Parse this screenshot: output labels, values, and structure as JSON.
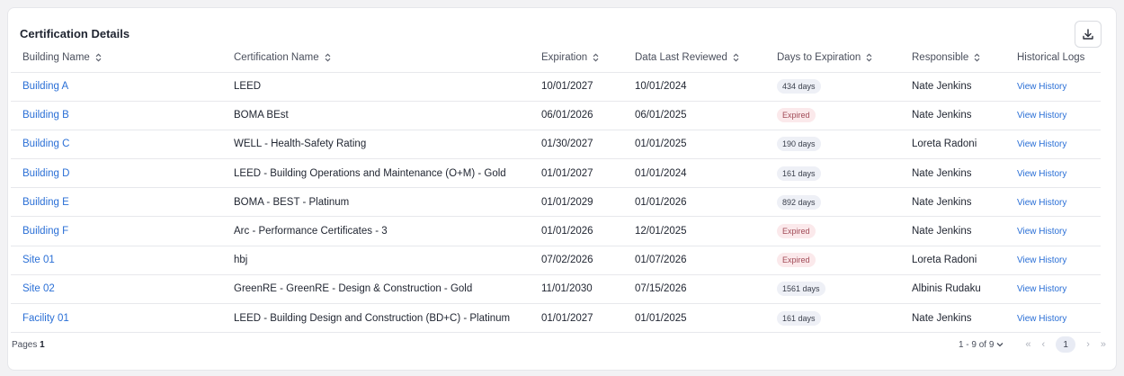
{
  "header": {
    "title": "Certification Details",
    "download_icon": "download-icon"
  },
  "columns": [
    "Building Name",
    "Certification Name",
    "Expiration",
    "Data Last Reviewed",
    "Days to Expiration",
    "Responsible",
    "Historical Logs"
  ],
  "rows": [
    {
      "building": "Building A",
      "certification": "LEED",
      "expiration": "10/01/2027",
      "reviewed": "10/01/2024",
      "days": "434 days",
      "status": "days",
      "responsible": "Nate Jenkins",
      "history": "View History"
    },
    {
      "building": "Building B",
      "certification": "BOMA BEst",
      "expiration": "06/01/2026",
      "reviewed": "06/01/2025",
      "days": "Expired",
      "status": "expired",
      "responsible": "Nate Jenkins",
      "history": "View History"
    },
    {
      "building": "Building C",
      "certification": "WELL - Health-Safety Rating",
      "expiration": "01/30/2027",
      "reviewed": "01/01/2025",
      "days": "190 days",
      "status": "days",
      "responsible": "Loreta Radoni",
      "history": "View History"
    },
    {
      "building": "Building D",
      "certification": "LEED - Building Operations and Maintenance (O+M) - Gold",
      "expiration": "01/01/2027",
      "reviewed": "01/01/2024",
      "days": "161 days",
      "status": "days",
      "responsible": "Nate Jenkins",
      "history": "View History"
    },
    {
      "building": "Building E",
      "certification": "BOMA - BEST - Platinum",
      "expiration": "01/01/2029",
      "reviewed": "01/01/2026",
      "days": "892 days",
      "status": "days",
      "responsible": "Nate Jenkins",
      "history": "View History"
    },
    {
      "building": "Building F",
      "certification": "Arc - Performance Certificates - 3",
      "expiration": "01/01/2026",
      "reviewed": "12/01/2025",
      "days": "Expired",
      "status": "expired",
      "responsible": "Nate Jenkins",
      "history": "View History"
    },
    {
      "building": "Site 01",
      "certification": "hbj",
      "expiration": "07/02/2026",
      "reviewed": "01/07/2026",
      "days": "Expired",
      "status": "expired",
      "responsible": "Loreta Radoni",
      "history": "View History"
    },
    {
      "building": "Site 02",
      "certification": "GreenRE - GreenRE - Design & Construction - Gold",
      "expiration": "11/01/2030",
      "reviewed": "07/15/2026",
      "days": "1561 days",
      "status": "days",
      "responsible": "Albinis Rudaku",
      "history": "View History"
    },
    {
      "building": "Facility 01",
      "certification": "LEED - Building Design and Construction (BD+C) - Platinum",
      "expiration": "01/01/2027",
      "reviewed": "01/01/2025",
      "days": "161 days",
      "status": "days",
      "responsible": "Nate Jenkins",
      "history": "View History"
    }
  ],
  "footer": {
    "pages_label": "Pages",
    "pages_value": "1",
    "range": "1 - 9 of 9",
    "current_page": "1",
    "nav_first": "«",
    "nav_prev": "‹",
    "nav_next": "›",
    "nav_last": "»"
  },
  "colors": {
    "link": "#2a6fd6",
    "expired_bg": "#fbe9eb",
    "days_bg": "#eef0f6"
  }
}
